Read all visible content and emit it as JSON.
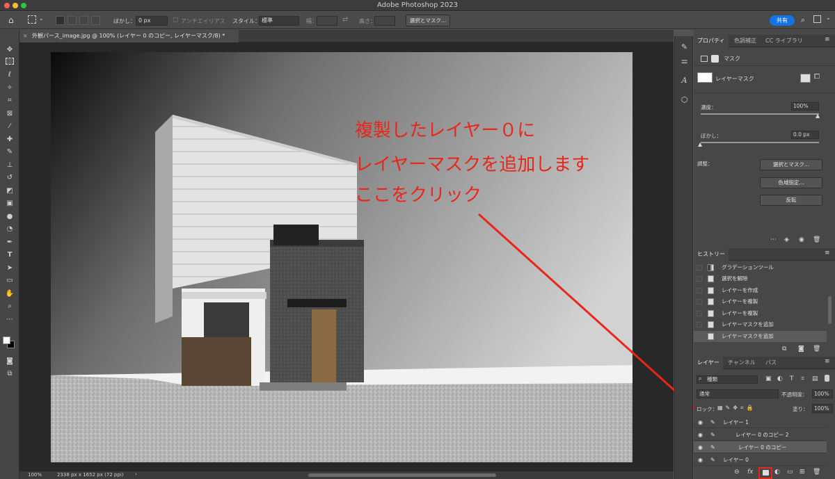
{
  "app": {
    "title": "Adobe Photoshop 2023"
  },
  "options_bar": {
    "feather_label": "ぼかし：",
    "feather_value": "0 px",
    "antialias_label": "アンチエイリアス",
    "style_label": "スタイル：",
    "style_value": "標準",
    "width_label": "幅：",
    "height_label": "高さ：",
    "select_mask_label": "選択とマスク...",
    "share_label": "共有"
  },
  "document": {
    "tab_title": "外観パース_image.jpg @ 100% (レイヤー 0 のコピー, レイヤーマスク/8) *",
    "zoom": "100%",
    "dimensions": "2338 px x 1652 px (72 ppi)"
  },
  "annotation": {
    "line1": "複製したレイヤー０に",
    "line2": "レイヤーマスクを追加します",
    "line3": "ここをクリック"
  },
  "properties": {
    "tabs": [
      "プロパティ",
      "色調補正",
      "CC ライブラリ"
    ],
    "section": "マスク",
    "mask_label": "レイヤーマスク",
    "density_label": "濃度：",
    "density_value": "100%",
    "feather_label": "ぼかし：",
    "feather_value": "0.0 px",
    "adjust_label": "調整：",
    "btn_select_mask": "選択とマスク...",
    "btn_color_range": "色域指定...",
    "btn_invert": "反転"
  },
  "history": {
    "title": "ヒストリー",
    "items": [
      "グラデーションツール",
      "選択を解除",
      "レイヤーを作成",
      "レイヤーを複製",
      "レイヤーを複製",
      "レイヤーマスクを追加",
      "レイヤーマスクを追加"
    ]
  },
  "layers_panel": {
    "tabs": [
      "レイヤー",
      "チャンネル",
      "パス"
    ],
    "filter_value": "種類",
    "blend_mode": "通常",
    "opacity_label": "不透明度：",
    "opacity_value": "100%",
    "lock_label": "ロック：",
    "fill_label": "塗り：",
    "fill_value": "100%",
    "layers": [
      "レイヤー 1",
      "レイヤー 0 のコピー 2",
      "レイヤー 0 のコピー",
      "レイヤー 0"
    ]
  },
  "colors": {
    "accent": "#1473e6",
    "annotation": "#e8261a"
  }
}
